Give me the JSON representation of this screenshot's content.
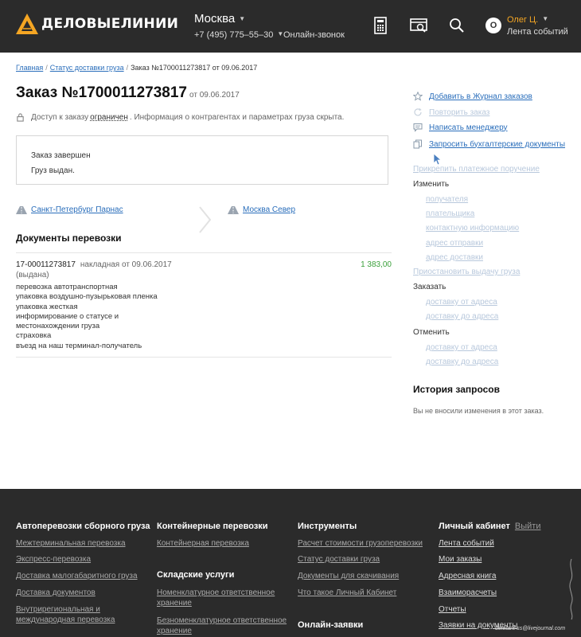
{
  "header": {
    "logo_text": "ДЕЛОВЫЕЛИНИИ",
    "city": "Москва",
    "phone": "+7 (495) 775–55–30",
    "online_call": "Онлайн-звонок",
    "user_initial": "О",
    "user_name": "Олег Ц.",
    "user_feed": "Лента событий",
    "accent_color": "#f5a623"
  },
  "breadcrumb": {
    "home": "Главная",
    "status": "Статус доставки груза",
    "current": "Заказ №1700011273817 от 09.06.2017"
  },
  "order": {
    "title": "Заказ №1700011273817",
    "date": "от 09.06.2017",
    "access_prefix": "Доступ к заказу",
    "access_limited": "ограничен",
    "access_suffix": ". Информация о контрагентах и параметрах груза скрыта.",
    "status_line1": "Заказ завершен",
    "status_line2": "Груз выдан.",
    "route_from": "Санкт-Петербург Парнас",
    "route_to": "Москва Север"
  },
  "documents": {
    "title": "Документы перевозки",
    "number": "17-00011273817",
    "type": "накладная от 09.06.2017",
    "sum": "1 383,00",
    "state": "(выдана)",
    "services": [
      "перевозка автотранспортная",
      "упаковка воздушно-пузырьковая пленка",
      "упаковка жесткая",
      "информирование о статусе и местонахождении груза",
      "страховка",
      "въезд на наш терминал-получатель"
    ]
  },
  "actions": {
    "add_journal": "Добавить в Журнал заказов",
    "repeat": "Повторить заказ",
    "write_manager": "Написать менеджеру",
    "request_docs": "Запросить бухгалтерские документы",
    "attach_payment": "Прикрепить платежное поручение",
    "change_label": "Изменить",
    "change_items": [
      "получателя",
      "плательщика",
      "контактную информацию",
      "адрес отправки",
      "адрес доставки"
    ],
    "suspend": "Приостановить выдачу груза",
    "order_label": "Заказать",
    "order_items": [
      "доставку от адреса",
      "доставку до адреса"
    ],
    "cancel_label": "Отменить",
    "cancel_items": [
      "доставку от адреса",
      "доставку до адреса"
    ]
  },
  "history": {
    "title": "История запросов",
    "empty": "Вы не вносили изменения в этот заказ."
  },
  "footer": {
    "col1": {
      "title": "Автоперевозки сборного груза",
      "links": [
        "Межтерминальная перевозка",
        "Экспресс-перевозка",
        "Доставка малогабаритного груза",
        "Доставка документов",
        "Внутрирегиональная и международная перевозка"
      ]
    },
    "col2": {
      "title": "Контейнерные перевозки",
      "links": [
        "Контейнерная перевозка"
      ],
      "title2": "Складские услуги",
      "links2": [
        "Номенклатурное ответственное хранение",
        "Безноменклатурное ответственное хранение"
      ]
    },
    "col3": {
      "title": "Инструменты",
      "links": [
        "Расчет стоимости грузоперевозки",
        "Статус доставки груза",
        "Документы для скачивания",
        "Что такое Личный Кабинет"
      ],
      "title2": "Онлайн-заявки"
    },
    "col4": {
      "title": "Личный кабинет",
      "exit": "Выйти",
      "links": [
        "Лента событий",
        "Мои заказы",
        "Адресная книга",
        "Взаиморасчеты",
        "Отчеты",
        "Заявки на документы"
      ]
    },
    "watermark": "deletant-ss@livejournal.com"
  }
}
